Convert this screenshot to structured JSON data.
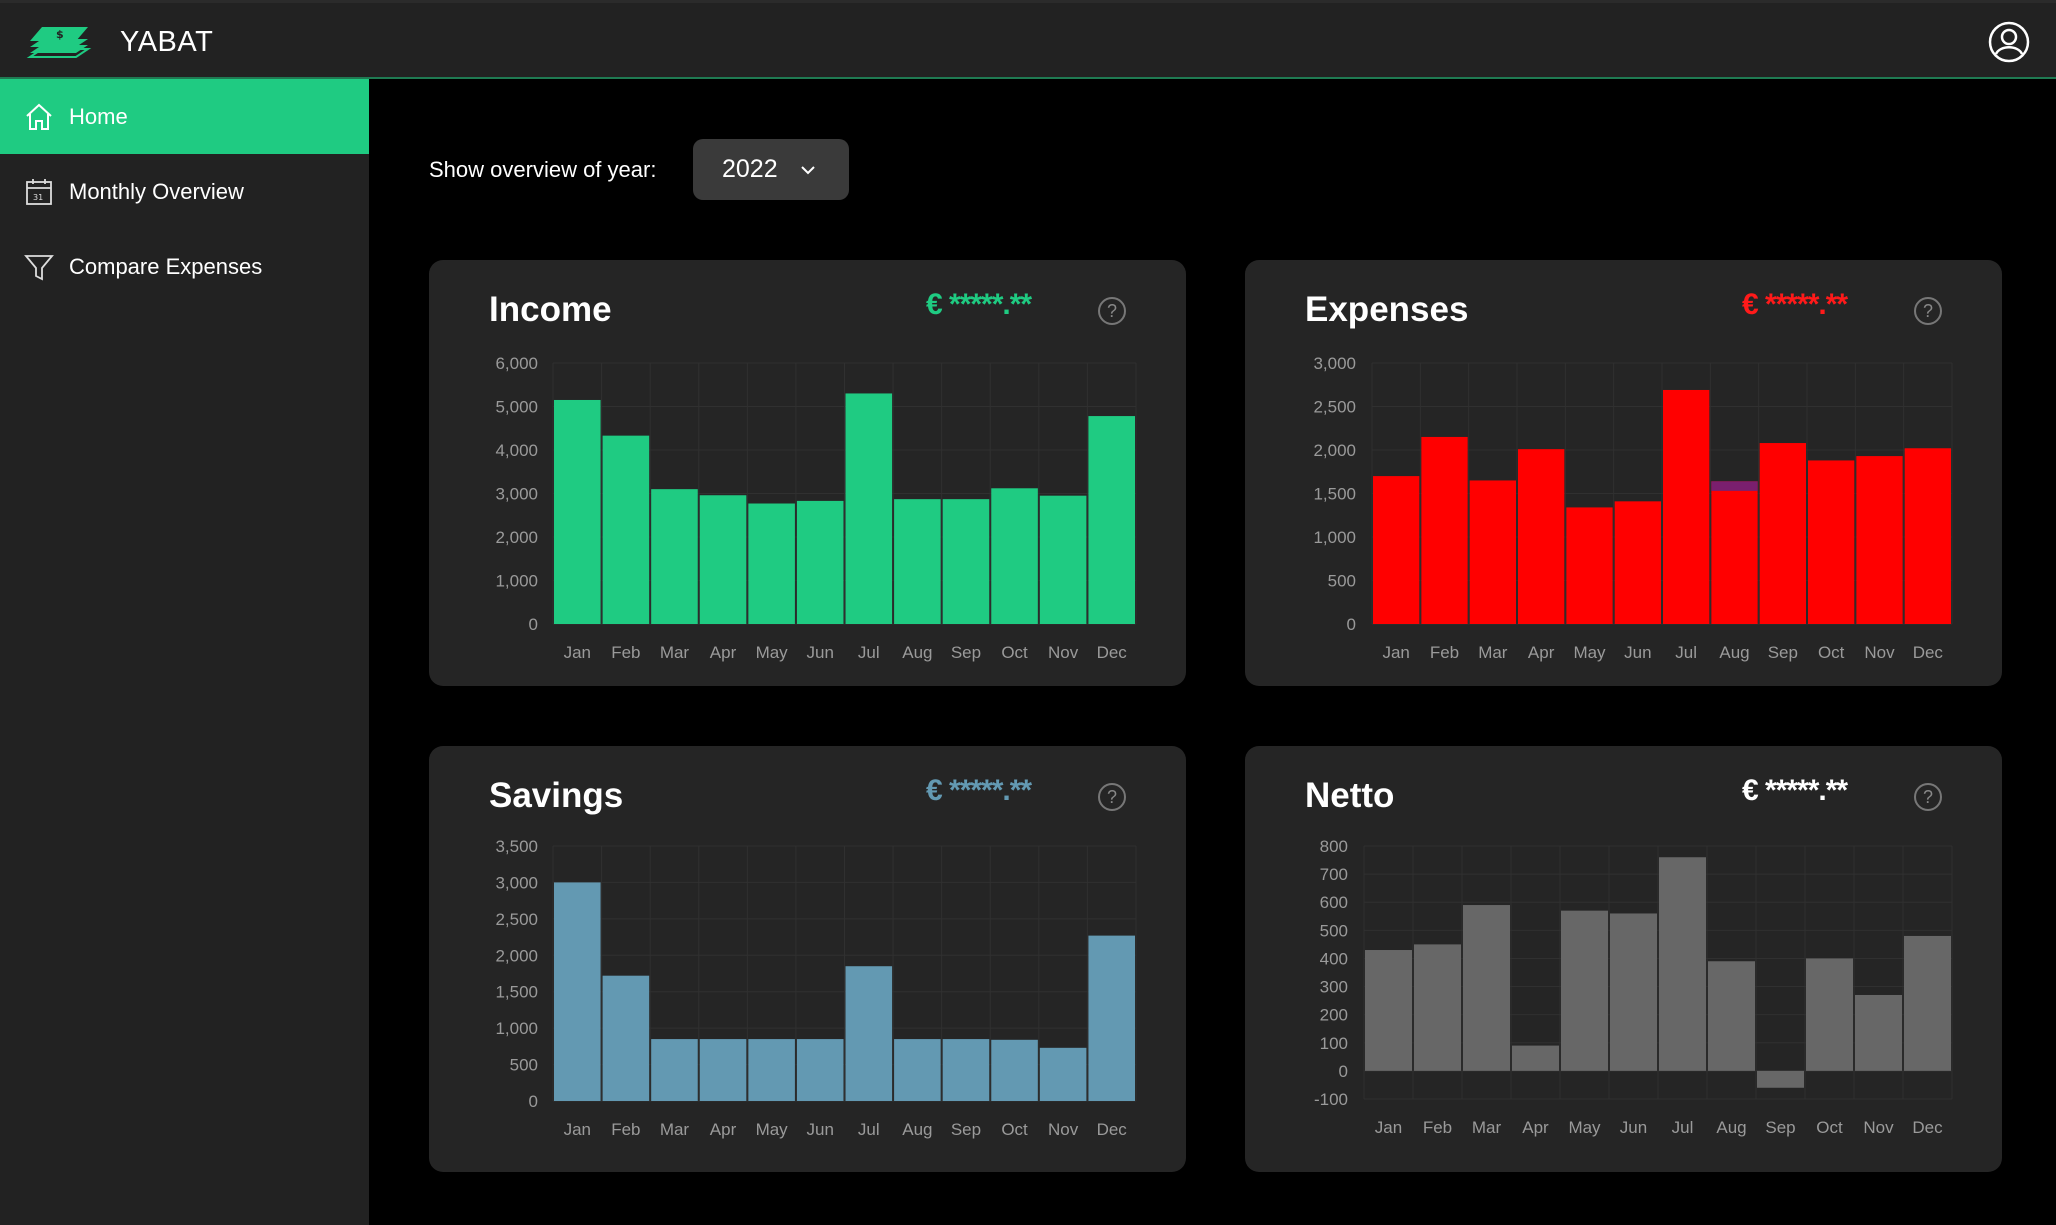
{
  "app": {
    "name": "YABAT"
  },
  "nav": [
    {
      "label": "Home",
      "icon": "home-icon",
      "active": true
    },
    {
      "label": "Monthly Overview",
      "icon": "calendar-icon",
      "active": false
    },
    {
      "label": "Compare Expenses",
      "icon": "filter-icon",
      "active": false
    }
  ],
  "year_selector": {
    "label": "Show overview of year:",
    "value": "2022"
  },
  "cards": {
    "income": {
      "title": "Income",
      "amount": "€ *****.**",
      "help": "?"
    },
    "expenses": {
      "title": "Expenses",
      "amount": "€ *****.**",
      "help": "?"
    },
    "savings": {
      "title": "Savings",
      "amount": "€ *****.**",
      "help": "?"
    },
    "netto": {
      "title": "Netto",
      "amount": "€ *****.**",
      "help": "?"
    }
  },
  "colors": {
    "accent": "#1fcb82",
    "income": "#1fcb82",
    "expenses": "#ff0000",
    "expenses_highlight": "#7a1f6e",
    "savings": "#6399b2",
    "netto": "#676767",
    "panel": "#252525",
    "sidebar": "#222222"
  },
  "chart_data": [
    {
      "id": "income",
      "type": "bar",
      "title": "Income",
      "categories": [
        "Jan",
        "Feb",
        "Mar",
        "Apr",
        "May",
        "Jun",
        "Jul",
        "Aug",
        "Sep",
        "Oct",
        "Nov",
        "Dec"
      ],
      "values": [
        5150,
        4330,
        3100,
        2960,
        2770,
        2830,
        5300,
        2870,
        2870,
        3120,
        2950,
        4780
      ],
      "yticks": [
        "0",
        "1,000",
        "2,000",
        "3,000",
        "4,000",
        "5,000",
        "6,000"
      ],
      "ylim": [
        0,
        6000
      ],
      "grid": true,
      "legend": "none"
    },
    {
      "id": "expenses",
      "type": "bar",
      "title": "Expenses",
      "categories": [
        "Jan",
        "Feb",
        "Mar",
        "Apr",
        "May",
        "Jun",
        "Jul",
        "Aug",
        "Sep",
        "Oct",
        "Nov",
        "Dec"
      ],
      "values": [
        1700,
        2150,
        1650,
        2010,
        1340,
        1410,
        2690,
        1640,
        2080,
        1880,
        1930,
        2020
      ],
      "highlight": {
        "index": 7,
        "from": 1530,
        "to": 1640
      },
      "yticks": [
        "0",
        "500",
        "1,000",
        "1,500",
        "2,000",
        "2,500",
        "3,000"
      ],
      "ylim": [
        0,
        3000
      ],
      "grid": true,
      "legend": "none"
    },
    {
      "id": "savings",
      "type": "bar",
      "title": "Savings",
      "categories": [
        "Jan",
        "Feb",
        "Mar",
        "Apr",
        "May",
        "Jun",
        "Jul",
        "Aug",
        "Sep",
        "Oct",
        "Nov",
        "Dec"
      ],
      "values": [
        3000,
        1720,
        850,
        850,
        850,
        850,
        1850,
        850,
        850,
        840,
        730,
        2270
      ],
      "yticks": [
        "0",
        "500",
        "1,000",
        "1,500",
        "2,000",
        "2,500",
        "3,000",
        "3,500"
      ],
      "ylim": [
        0,
        3500
      ],
      "grid": true,
      "legend": "none"
    },
    {
      "id": "netto",
      "type": "bar",
      "title": "Netto",
      "categories": [
        "Jan",
        "Feb",
        "Mar",
        "Apr",
        "May",
        "Jun",
        "Jul",
        "Aug",
        "Sep",
        "Oct",
        "Nov",
        "Dec"
      ],
      "values": [
        430,
        450,
        590,
        90,
        570,
        560,
        760,
        390,
        -60,
        400,
        270,
        480
      ],
      "yticks": [
        "-100",
        "0",
        "100",
        "200",
        "300",
        "400",
        "500",
        "600",
        "700",
        "800"
      ],
      "ylim": [
        -100,
        800
      ],
      "grid": true,
      "legend": "none"
    }
  ]
}
